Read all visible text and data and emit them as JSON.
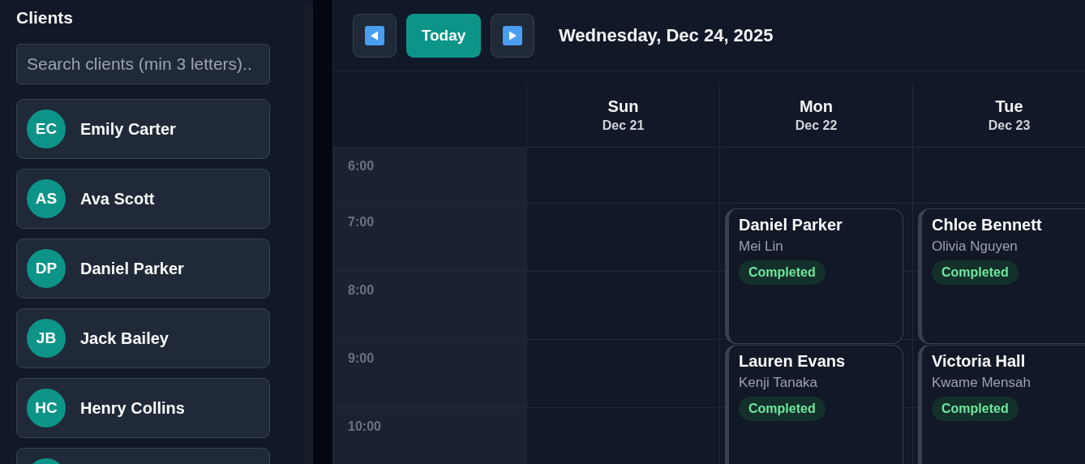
{
  "sidebar": {
    "title": "Clients",
    "search": {
      "placeholder": "Search clients (min 3 letters).."
    },
    "clients": [
      {
        "initials": "EC",
        "name": "Emily Carter"
      },
      {
        "initials": "AS",
        "name": "Ava Scott"
      },
      {
        "initials": "DP",
        "name": "Daniel Parker"
      },
      {
        "initials": "JB",
        "name": "Jack Bailey"
      },
      {
        "initials": "HC",
        "name": "Henry Collins"
      }
    ]
  },
  "toolbar": {
    "today_button": "Today",
    "date": "Wednesday, Dec 24, 2025"
  },
  "calendar": {
    "days": [
      {
        "name": "Sun",
        "date": "Dec 21"
      },
      {
        "name": "Mon",
        "date": "Dec 22"
      },
      {
        "name": "Tue",
        "date": "Dec 23"
      }
    ],
    "hours": [
      {
        "label": "6:00",
        "cells": [
          [],
          [],
          []
        ]
      },
      {
        "label": "7:00",
        "cells": [
          [],
          [
            {
              "client": "Daniel Parker",
              "staff": "Mei Lin",
              "status": "Completed"
            }
          ],
          [
            {
              "client": "Chloe Bennett",
              "staff": "Olivia Nguyen",
              "status": "Completed"
            }
          ]
        ]
      },
      {
        "label": "8:00",
        "cells": [
          [],
          [],
          []
        ]
      },
      {
        "label": "9:00",
        "cells": [
          [],
          [
            {
              "client": "Lauren Evans",
              "staff": "Kenji Tanaka",
              "status": "Completed"
            }
          ],
          [
            {
              "client": "Victoria Hall",
              "staff": "Kwame Mensah",
              "status": "Completed"
            }
          ]
        ]
      },
      {
        "label": "10:00",
        "cells": [
          [],
          [],
          []
        ]
      }
    ]
  }
}
